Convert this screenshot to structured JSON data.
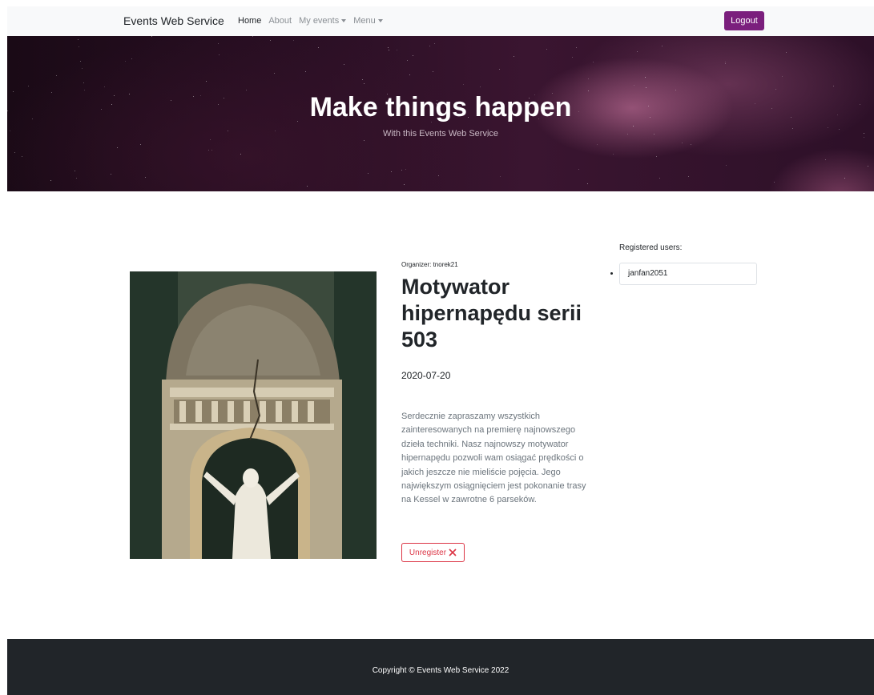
{
  "navbar": {
    "brand": "Events Web Service",
    "links": [
      {
        "label": "Home",
        "active": true
      },
      {
        "label": "About",
        "active": false
      },
      {
        "label": "My events",
        "dropdown": true
      },
      {
        "label": "Menu",
        "dropdown": true
      }
    ],
    "logout_label": "Logout"
  },
  "hero": {
    "title": "Make things happen",
    "subtitle": "With this Events Web Service"
  },
  "event": {
    "organizer": "Organizer: tnorek21",
    "title": "Motywator hipernapędu serii 503",
    "date": "2020-07-20",
    "description": "Serdecznie zapraszamy wszystkich zainteresowanych na premierę najnowszego dzieła techniki. Nasz najnowszy motywator hipernapędu pozwoli wam osiągać prędkości o jakich jeszcze nie mieliście pojęcia. Jego największym osiągnięciem jest pokonanie trasy na Kessel w zawrotne 6 parseków.",
    "unregister_label": "Unregister"
  },
  "registered": {
    "label": "Registered users:",
    "users": [
      "janfan2051"
    ]
  },
  "footer": {
    "copyright": "Copyright © Events Web Service 2022"
  },
  "colors": {
    "primary": "#7b1f7d",
    "danger": "#dc3545",
    "footer_bg": "#212529",
    "navbar_bg": "#f8f9fa"
  }
}
